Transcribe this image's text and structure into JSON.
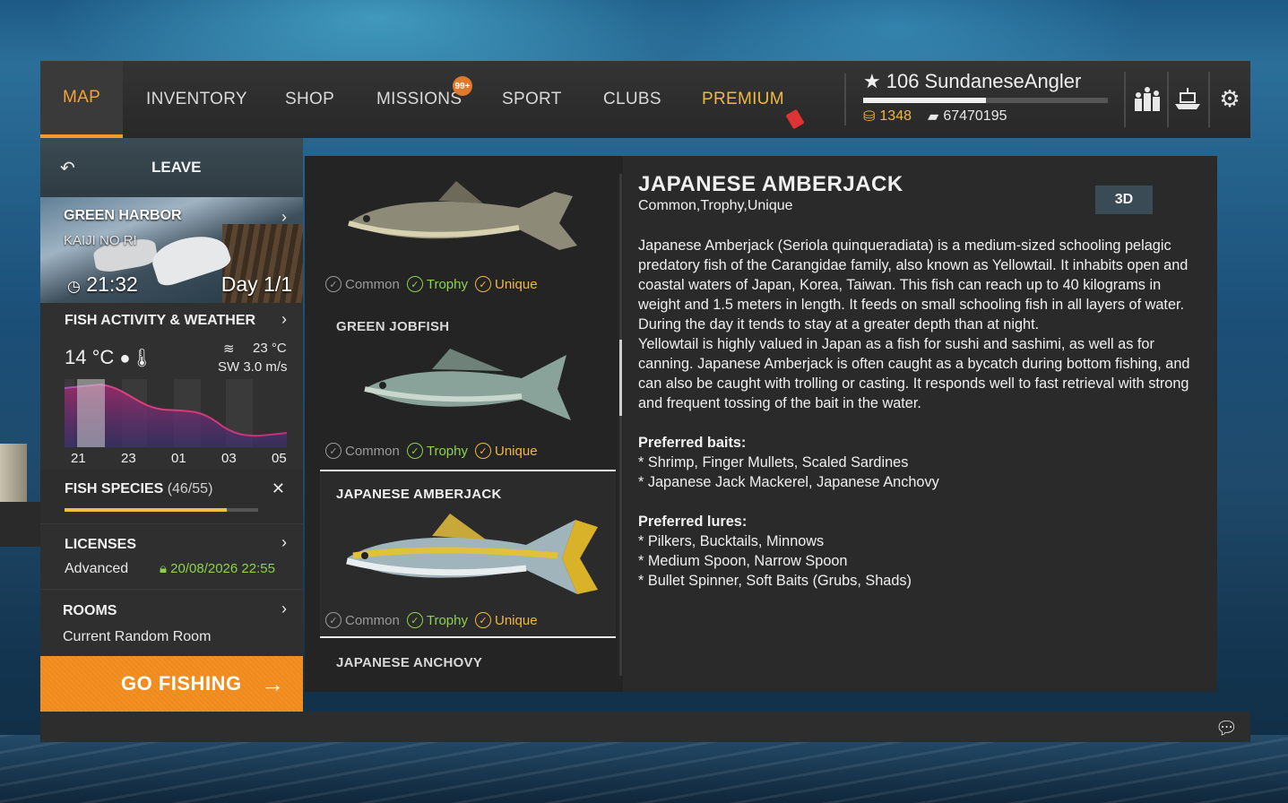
{
  "nav": {
    "items": [
      "MAP",
      "INVENTORY",
      "SHOP",
      "MISSIONS",
      "SPORT",
      "CLUBS",
      "PREMIUM"
    ],
    "missions_badge": "99+"
  },
  "player": {
    "level": "106",
    "name": "SundaneseAngler",
    "gold": "1348",
    "credits": "67470195"
  },
  "left": {
    "leave_label": "LEAVE",
    "location": "GREEN HARBOR",
    "sublocation": "KAIJI NO RI",
    "time": "21:32",
    "day": "Day 1/1",
    "weather_title": "FISH ACTIVITY & WEATHER",
    "air_temp": "14 °C",
    "water_temp": "23 °C",
    "wind": "SW 3.0 m/s",
    "hours": [
      "21",
      "23",
      "01",
      "03",
      "05"
    ],
    "species_title": "FISH SPECIES",
    "species_count": "(46/55)",
    "species_progress": 0.84,
    "licenses_title": "LICENSES",
    "license_type": "Advanced",
    "license_expiry": "20/08/2026 22:55",
    "rooms_title": "ROOMS",
    "room_name": "Current Random Room",
    "go_fishing": "GO FISHING"
  },
  "fish_list": [
    {
      "name": "",
      "tags": [
        "Common",
        "Trophy",
        "Unique"
      ]
    },
    {
      "name": "GREEN JOBFISH",
      "tags": [
        "Common",
        "Trophy",
        "Unique"
      ]
    },
    {
      "name": "JAPANESE AMBERJACK",
      "tags": [
        "Common",
        "Trophy",
        "Unique"
      ],
      "selected": true
    },
    {
      "name": "JAPANESE ANCHOVY"
    }
  ],
  "detail": {
    "title": "JAPANESE AMBERJACK",
    "subtitle": "Common,Trophy,Unique",
    "btn_3d": "3D",
    "description": "Japanese Amberjack (Seriola quinqueradiata) is a medium-sized schooling pelagic predatory fish of the Carangidae family, also known as Yellowtail. It inhabits open and coastal waters of Japan, Korea, Taiwan. This fish can reach up to 40 kilograms in weight and 1.5 meters in length. It feeds on small schooling fish in all layers of water. During the day it tends to stay at a greater depth than at night.",
    "description2": "Yellowtail is highly valued in Japan as a fish for sushi and sashimi, as well as for canning. Japanese Amberjack is often caught as a bycatch during bottom fishing, and can also be caught with trolling or casting. It responds well to fast retrieval with strong and frequent tossing of the bait in the water.",
    "baits_title": "Preferred baits:",
    "baits": [
      "* Shrimp, Finger Mullets, Scaled Sardines",
      "* Japanese Jack Mackerel, Japanese Anchovy"
    ],
    "lures_title": "Preferred lures:",
    "lures": [
      "* Pilkers, Bucktails, Minnows",
      "* Medium Spoon, Narrow Spoon",
      "* Bullet Spinner, Soft Baits (Grubs, Shads)"
    ]
  },
  "colors": {
    "accent": "#f29a2e",
    "trophy": "#8ed24a",
    "unique": "#f0b840",
    "go_fishing": "#f08a1a"
  },
  "icons": [
    "back-arrow-icon",
    "chevron-right-icon",
    "clock-icon",
    "sun-cloud-icon",
    "thermometer-icon",
    "waves-icon",
    "close-icon",
    "lock-icon",
    "arrow-right-icon",
    "star-icon",
    "coins-icon",
    "money-icon",
    "leaderboard-icon",
    "boat-icon",
    "gear-icon",
    "chat-icon"
  ]
}
